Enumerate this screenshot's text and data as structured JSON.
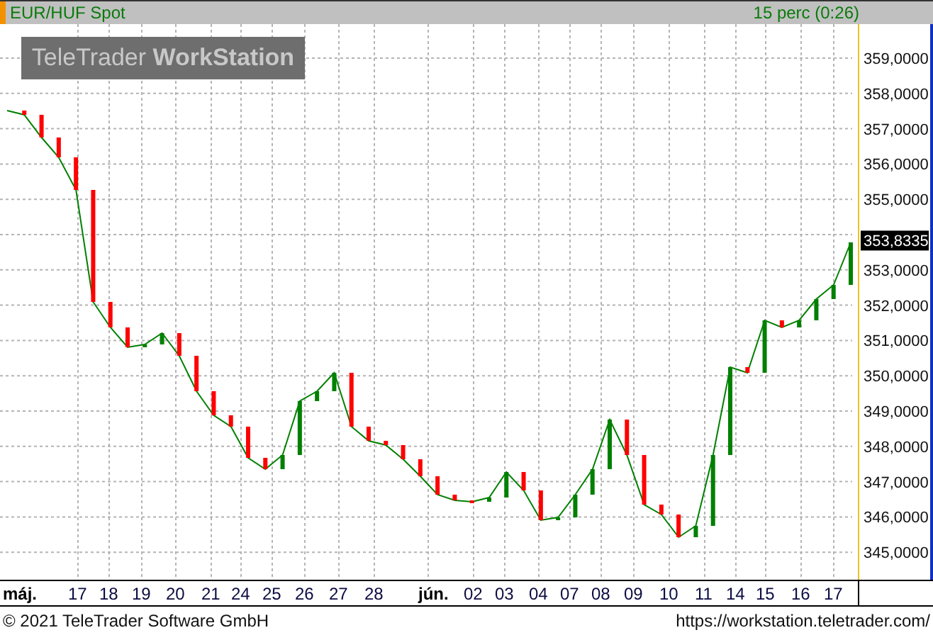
{
  "header": {
    "title": "EUR/HUF Spot",
    "period": "15 perc (0:26)"
  },
  "logo": "TeleTrader **WorkStation**",
  "chart": {
    "y_axis_labels": [
      "359,0000",
      "358,0000",
      "357,0000",
      "356,0000",
      "355,0000",
      "353,0000",
      "352,0000",
      "351,0000",
      "350,0000",
      "349,0000",
      "348,0000",
      "347,0000",
      "346,0000",
      "345,0000"
    ],
    "last_price": "353,8335",
    "x_axis_labels": [
      {
        "label": "máj.",
        "kind": "month"
      },
      {
        "label": "17",
        "kind": "day"
      },
      {
        "label": "18",
        "kind": "day"
      },
      {
        "label": "19",
        "kind": "day"
      },
      {
        "label": "20",
        "kind": "day"
      },
      {
        "label": "21",
        "kind": "day"
      },
      {
        "label": "24",
        "kind": "day"
      },
      {
        "label": "25",
        "kind": "day"
      },
      {
        "label": "26",
        "kind": "day"
      },
      {
        "label": "27",
        "kind": "day"
      },
      {
        "label": "28",
        "kind": "day"
      },
      {
        "label": "jún.",
        "kind": "month"
      },
      {
        "label": "02",
        "kind": "day"
      },
      {
        "label": "03",
        "kind": "day"
      },
      {
        "label": "04",
        "kind": "day"
      },
      {
        "label": "07",
        "kind": "day"
      },
      {
        "label": "08",
        "kind": "day"
      },
      {
        "label": "09",
        "kind": "day"
      },
      {
        "label": "10",
        "kind": "day"
      },
      {
        "label": "11",
        "kind": "day"
      },
      {
        "label": "14",
        "kind": "day"
      },
      {
        "label": "15",
        "kind": "day"
      },
      {
        "label": "16",
        "kind": "day"
      },
      {
        "label": "17",
        "kind": "day"
      }
    ]
  },
  "footer": {
    "copyright": "© 2021 TeleTrader Software GmbH",
    "url": "https://workstation.teletrader.com/"
  }
}
